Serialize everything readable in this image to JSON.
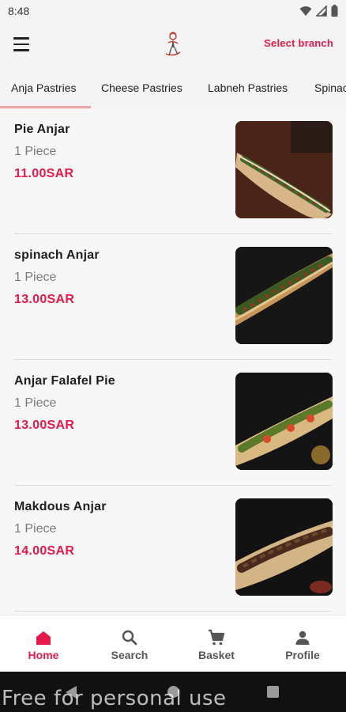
{
  "status_bar": {
    "time": "8:48",
    "icons": [
      "wifi-icon",
      "signal-icon",
      "battery-icon"
    ]
  },
  "app_bar": {
    "menu_icon": "hamburger-menu-icon",
    "logo_icon": "chef-logo-icon",
    "select_branch_label": "Select branch"
  },
  "tabs": [
    {
      "label": "Anja Pastries",
      "active": true
    },
    {
      "label": "Cheese Pastries",
      "active": false
    },
    {
      "label": "Labneh Pastries",
      "active": false
    },
    {
      "label": "Spinac",
      "active": false
    }
  ],
  "products": [
    {
      "name": "Pie Anjar",
      "quantity": "1 Piece",
      "price": "11.00SAR"
    },
    {
      "name": "spinach Anjar",
      "quantity": "1 Piece",
      "price": "13.00SAR"
    },
    {
      "name": "Anjar Falafel Pie",
      "quantity": "1 Piece",
      "price": "13.00SAR"
    },
    {
      "name": "Makdous Anjar",
      "quantity": "1 Piece",
      "price": "14.00SAR"
    }
  ],
  "bottom_nav": [
    {
      "label": "Home",
      "icon": "home-icon",
      "active": true
    },
    {
      "label": "Search",
      "icon": "search-icon",
      "active": false
    },
    {
      "label": "Basket",
      "icon": "cart-icon",
      "active": false
    },
    {
      "label": "Profile",
      "icon": "profile-icon",
      "active": false
    }
  ],
  "watermark": "Free for personal use",
  "colors": {
    "accent": "#e6194b",
    "tab_indicator": "#f2a1a8",
    "background": "#f4f4f4"
  }
}
